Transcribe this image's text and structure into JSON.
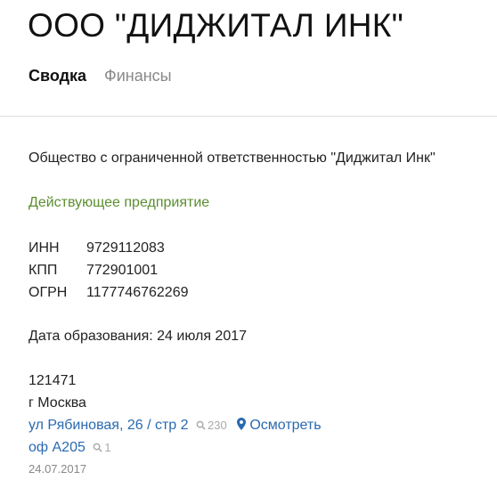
{
  "company": {
    "title": "ООО \"ДИДЖИТАЛ ИНК\""
  },
  "tabs": [
    {
      "label": "Сводка",
      "active": true
    },
    {
      "label": "Финансы",
      "active": false
    }
  ],
  "summary": {
    "full_name": "Общество с ограниченной ответственностью \"Диджитал Инк\"",
    "status": "Действующее предприятие",
    "status_color": "#5b8f2f",
    "ids": [
      {
        "label": "ИНН",
        "value": "9729112083"
      },
      {
        "label": "КПП",
        "value": "772901001"
      },
      {
        "label": "ОГРН",
        "value": "1177746762269"
      }
    ],
    "founded": "Дата образования: 24 июля 2017",
    "address": {
      "postcode": "121471",
      "city": "г Москва",
      "street": "ул Рябиновая, 26 / стр 2",
      "street_count": "230",
      "map_label": "Осмотреть",
      "office": "оф А205",
      "office_count": "1",
      "date": "24.07.2017"
    }
  },
  "colors": {
    "link": "#2a6ab0",
    "muted": "#888888"
  },
  "icons": {
    "search": "search-icon",
    "map_marker": "map-marker-icon"
  }
}
